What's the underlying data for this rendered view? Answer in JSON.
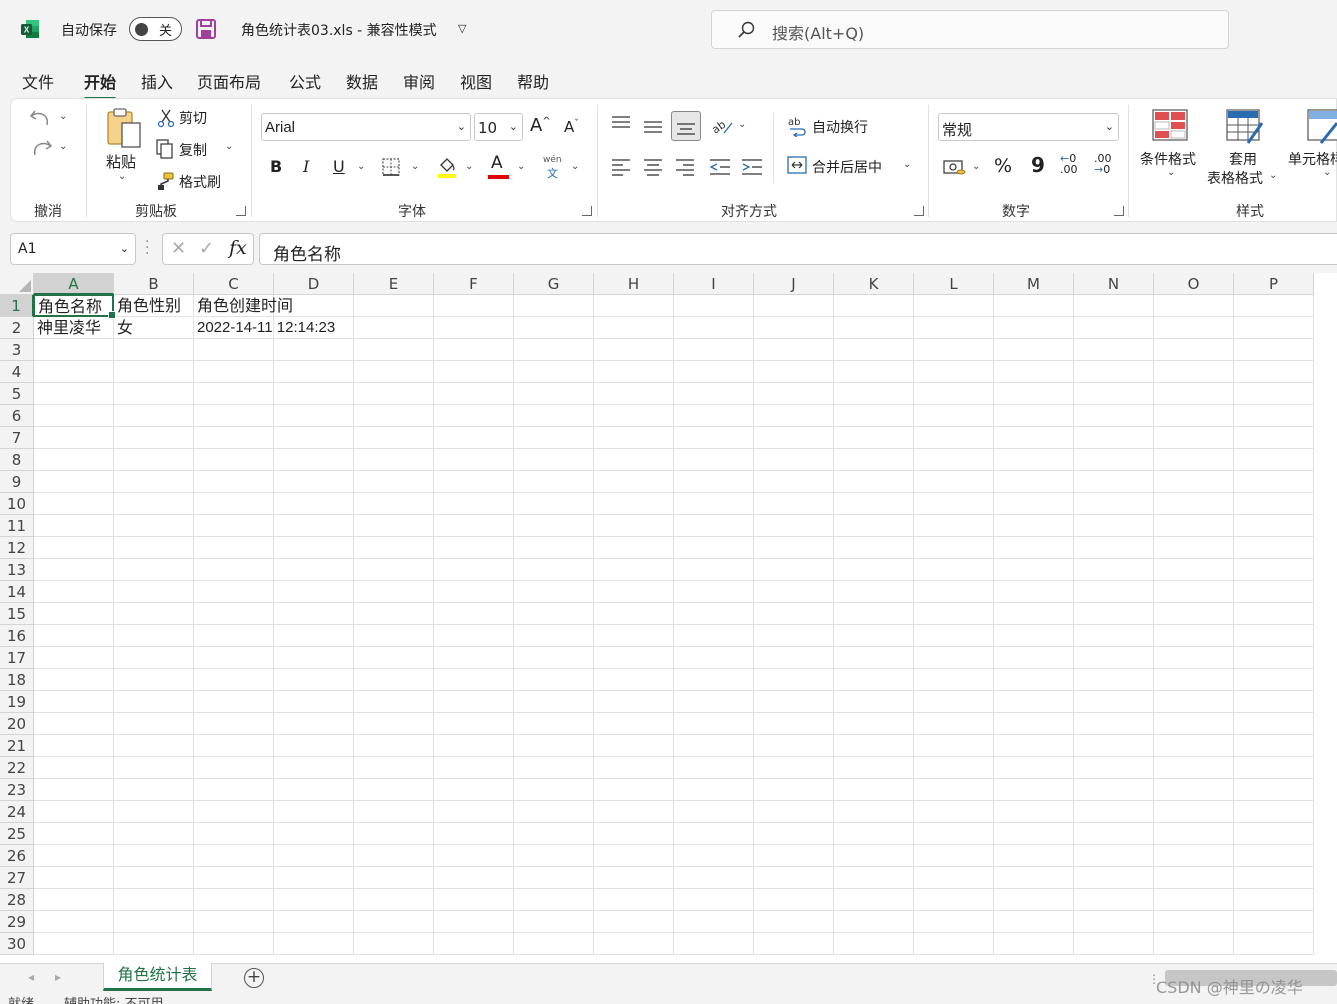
{
  "titlebar": {
    "autosave_label": "自动保存",
    "autosave_state": "关",
    "document_title": "角色统计表03.xls  -  兼容性模式",
    "search_placeholder": "搜索(Alt+Q)"
  },
  "menu": {
    "tabs": [
      {
        "label": "文件"
      },
      {
        "label": "开始",
        "active": true
      },
      {
        "label": "插入"
      },
      {
        "label": "页面布局"
      },
      {
        "label": "公式"
      },
      {
        "label": "数据"
      },
      {
        "label": "审阅"
      },
      {
        "label": "视图"
      },
      {
        "label": "帮助"
      }
    ]
  },
  "ribbon": {
    "groups": {
      "undo": "撤消",
      "clipboard": "剪贴板",
      "font": "字体",
      "alignment": "对齐方式",
      "number": "数字",
      "styles": "样式"
    },
    "clipboard": {
      "paste": "粘贴",
      "cut": "剪切",
      "copy": "复制",
      "format_painter": "格式刷"
    },
    "font": {
      "name": "Arial",
      "size": "10",
      "bold": "B",
      "italic": "I",
      "underline": "U",
      "grow": "A",
      "shrink": "A",
      "font_color_glyph": "A",
      "phonetic_top": "wén",
      "phonetic_bottom": "文",
      "fill_color": "#ffff00",
      "font_color": "#e00000"
    },
    "alignment": {
      "wrap_text": "自动换行",
      "merge_center": "合并后居中"
    },
    "number": {
      "format": "常规",
      "percent": "%",
      "comma": "9",
      "increase_decimal": ".00",
      "decrease_decimal": ".00"
    },
    "styles": {
      "conditional": "条件格式",
      "table_format_1": "套用",
      "table_format_2": "表格格式",
      "cell_styles": "单元格样"
    }
  },
  "formula_bar": {
    "name_box": "A1",
    "fx": "fx",
    "value": "角色名称"
  },
  "grid": {
    "columns": [
      "A",
      "B",
      "C",
      "D",
      "E",
      "F",
      "G",
      "H",
      "I",
      "J",
      "K",
      "L",
      "M",
      "N",
      "O",
      "P"
    ],
    "rows": [
      "1",
      "2",
      "3",
      "4",
      "5",
      "6",
      "7",
      "8",
      "9",
      "10",
      "11",
      "12",
      "13",
      "14",
      "15",
      "16",
      "17",
      "18",
      "19",
      "20",
      "21",
      "22",
      "23",
      "24",
      "25",
      "26",
      "27",
      "28",
      "29",
      "30"
    ],
    "cells": {
      "A1": "角色名称",
      "B1": "角色性别",
      "C1": "角色创建时间",
      "A2": "神里凌华",
      "B2": "女",
      "C2": "2022-14-11 12:14:23"
    },
    "selected_cell": "A1"
  },
  "sheets": {
    "tabs": [
      "角色统计表"
    ],
    "add_label": "+"
  },
  "statusbar": {
    "ready": "就绪",
    "accessibility": "辅助功能: 不可用"
  },
  "watermark": "CSDN @神里の凌华",
  "colors": {
    "accent": "#217346",
    "ribbon_bg": "#ffffff",
    "app_bg": "#f3f3f3"
  }
}
